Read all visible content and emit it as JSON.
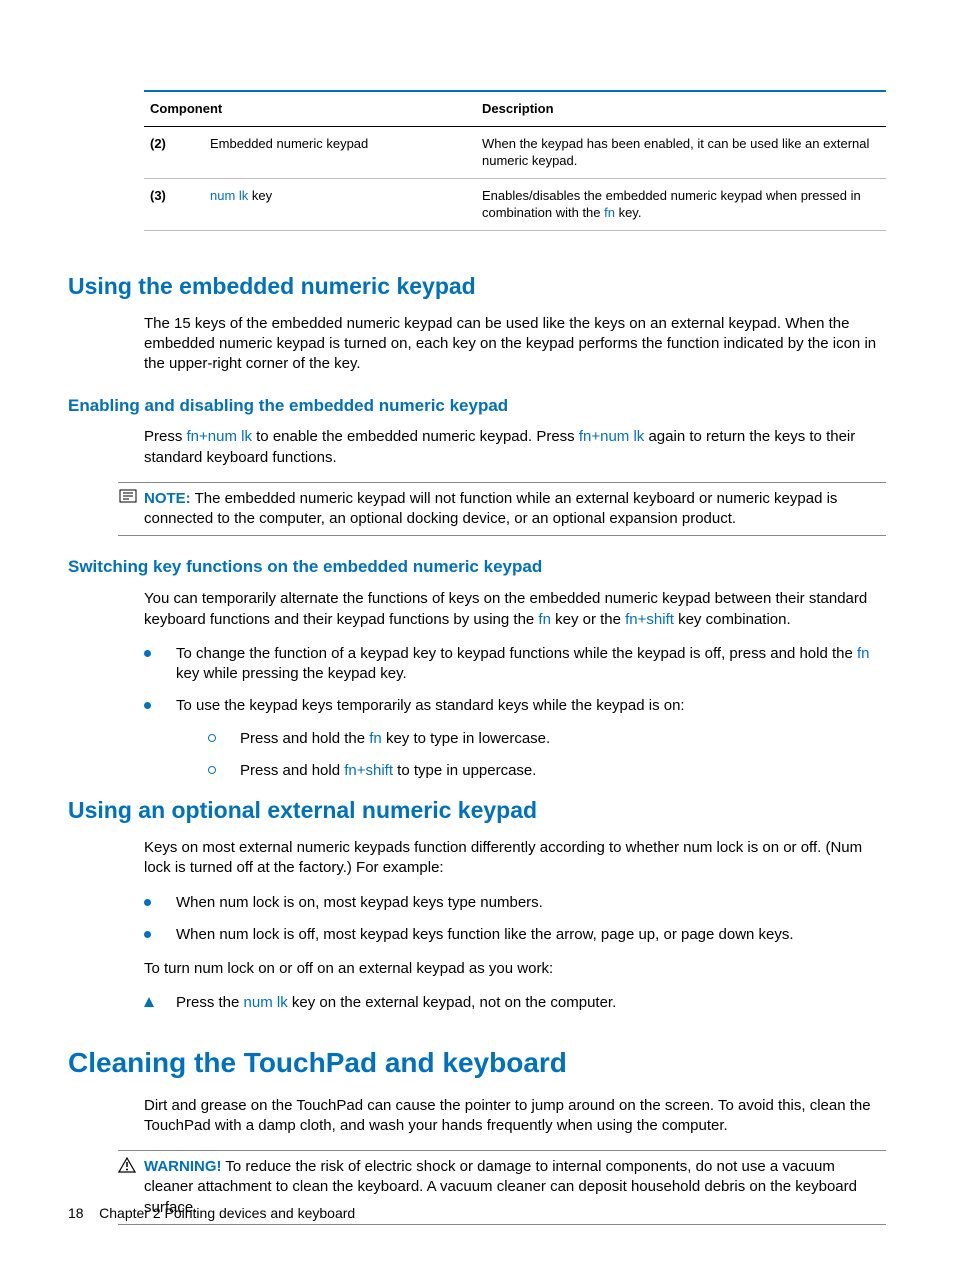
{
  "table": {
    "headers": {
      "component": "Component",
      "description": "Description"
    },
    "rows": [
      {
        "idx": "(2)",
        "component": "Embedded numeric keypad",
        "component_key": "",
        "component_suffix": "",
        "desc_prefix": "When the keypad has been enabled, it can be used like an external numeric keypad.",
        "desc_key": "",
        "desc_suffix": ""
      },
      {
        "idx": "(3)",
        "component": "",
        "component_key": "num lk",
        "component_suffix": " key",
        "desc_prefix": "Enables/disables the embedded numeric keypad when pressed in combination with the ",
        "desc_key": "fn",
        "desc_suffix": " key."
      }
    ]
  },
  "h2_using_embedded": "Using the embedded numeric keypad",
  "p_using_embedded": "The 15 keys of the embedded numeric keypad can be used like the keys on an external keypad. When the embedded numeric keypad is turned on, each key on the keypad performs the function indicated by the icon in the upper-right corner of the key.",
  "h3_enabling": "Enabling and disabling the embedded numeric keypad",
  "p_enabling_a": "Press ",
  "p_enabling_key1": "fn+num lk",
  "p_enabling_b": " to enable the embedded numeric keypad. Press ",
  "p_enabling_key2": "fn+num lk",
  "p_enabling_c": " again to return the keys to their standard keyboard functions.",
  "note_label": "NOTE:",
  "note_text": " The embedded numeric keypad will not function while an external keyboard or numeric keypad is connected to the computer, an optional docking device, or an optional expansion product.",
  "h3_switching": "Switching key functions on the embedded numeric keypad",
  "p_switching_a": "You can temporarily alternate the functions of keys on the embedded numeric keypad between their standard keyboard functions and their keypad functions by using the ",
  "p_switching_key1": "fn",
  "p_switching_b": " key or the ",
  "p_switching_key2": "fn+shift",
  "p_switching_c": " key combination.",
  "bullets_switch": {
    "b1_a": "To change the function of a keypad key to keypad functions while the keypad is off, press and hold the ",
    "b1_key": "fn",
    "b1_b": " key while pressing the keypad key.",
    "b2": "To use the keypad keys temporarily as standard keys while the keypad is on:",
    "sub1_a": "Press and hold the ",
    "sub1_key": "fn",
    "sub1_b": " key to type in lowercase.",
    "sub2_a": "Press and hold ",
    "sub2_key": "fn+shift",
    "sub2_b": " to type in uppercase."
  },
  "h2_external": "Using an optional external numeric keypad",
  "p_external": "Keys on most external numeric keypads function differently according to whether num lock is on or off. (Num lock is turned off at the factory.) For example:",
  "bullets_ext": {
    "b1": "When num lock is on, most keypad keys type numbers.",
    "b2": "When num lock is off, most keypad keys function like the arrow, page up, or page down keys."
  },
  "p_external_turn": "To turn num lock on or off on an external keypad as you work:",
  "tri_bullet_a": "Press the ",
  "tri_bullet_key": "num lk",
  "tri_bullet_b": " key on the external keypad, not on the computer.",
  "h1_cleaning": "Cleaning the TouchPad and keyboard",
  "p_cleaning": "Dirt and grease on the TouchPad can cause the pointer to jump around on the screen. To avoid this, clean the TouchPad with a damp cloth, and wash your hands frequently when using the computer.",
  "warn_label": "WARNING!",
  "warn_text": " To reduce the risk of electric shock or damage to internal components, do not use a vacuum cleaner attachment to clean the keyboard. A vacuum cleaner can deposit household debris on the keyboard surface.",
  "footer": {
    "page_no": "18",
    "chapter": "Chapter 2   Pointing devices and keyboard"
  }
}
